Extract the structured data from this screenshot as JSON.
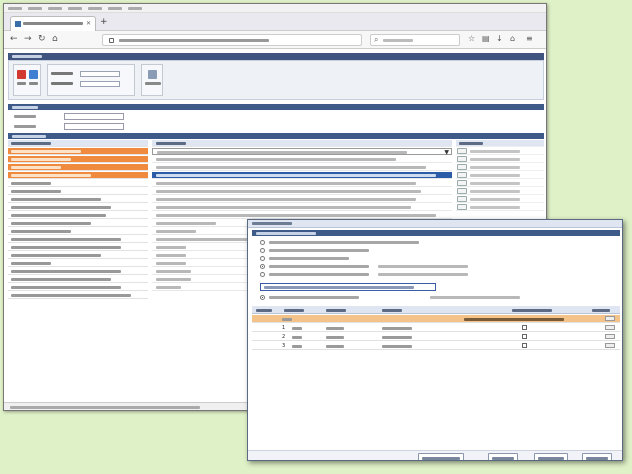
{
  "browser": {
    "menu": [
      "",
      "",
      "",
      "",
      "",
      "",
      ""
    ],
    "tab_title": "",
    "url": "",
    "search_placeholder": ""
  },
  "app": {
    "title": "",
    "toolbar": {
      "btn1": "",
      "btn2": "",
      "field1_label": "",
      "field2_label": "",
      "btn3": ""
    },
    "section1": "",
    "section2": "",
    "statusbar": ""
  },
  "dialog": {
    "title": "",
    "section": "",
    "options": [
      "",
      "",
      "",
      "",
      "",
      ""
    ],
    "input_value": "",
    "table_headers": [
      "",
      "",
      "",
      "",
      "",
      ""
    ],
    "rows": [
      {
        "no": "",
        "name": "",
        "status": "",
        "checked": false,
        "highlight": true
      },
      {
        "no": "1",
        "name": "",
        "status": "",
        "checked": true,
        "highlight": false
      },
      {
        "no": "2",
        "name": "",
        "status": "",
        "checked": true,
        "highlight": false
      },
      {
        "no": "3",
        "name": "",
        "status": "",
        "checked": true,
        "highlight": false
      }
    ],
    "footer_buttons": [
      "",
      "",
      "",
      ""
    ]
  },
  "colors": {
    "page_bg": "#dff1c7",
    "header_bar": "#3e5a88",
    "orange_row": "#f08a3e",
    "selected_row": "#2a5ca8",
    "highlight_row": "#f4c38a"
  }
}
